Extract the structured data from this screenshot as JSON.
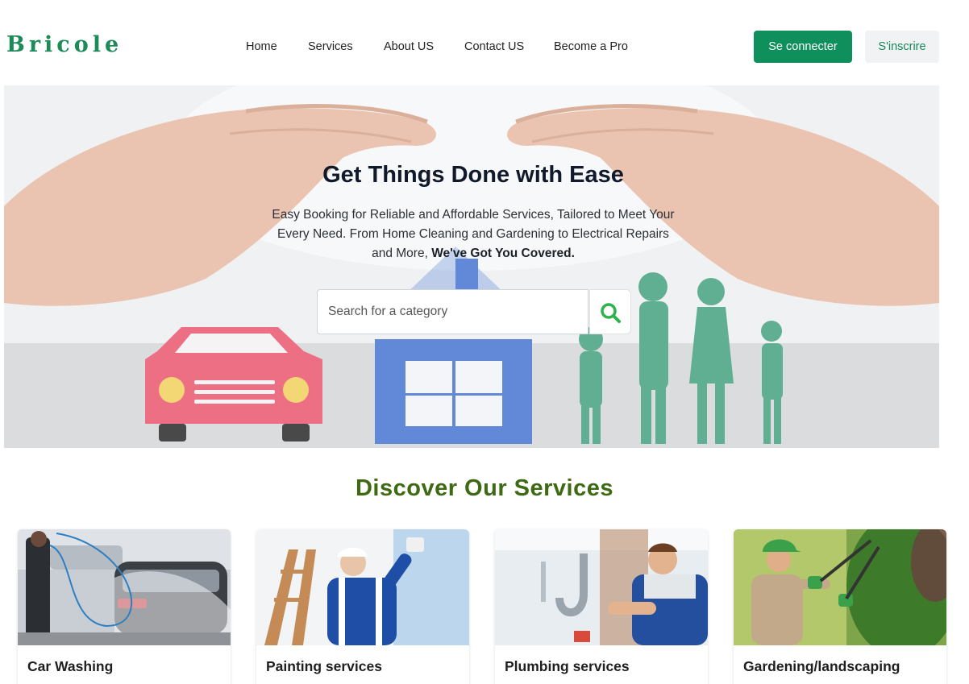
{
  "header": {
    "logo": "Bricole",
    "nav": [
      "Home",
      "Services",
      "About US",
      "Contact US",
      "Become a Pro"
    ],
    "login_label": "Se connecter",
    "signup_label": "S'inscrire"
  },
  "hero": {
    "title": "Get Things Done with Ease",
    "text": "Easy Booking for Reliable and Affordable Services, Tailored to Meet Your Every Need. From Home Cleaning and Gardening to Electrical Repairs and More,",
    "text_bold": "We've Got You Covered.",
    "search_placeholder": "Search for a category",
    "search_icon": "search-icon"
  },
  "services": {
    "title": "Discover Our Services",
    "items": [
      {
        "label": "Car Washing"
      },
      {
        "label": "Painting services"
      },
      {
        "label": "Plumbing services"
      },
      {
        "label": "Gardening/landscaping"
      }
    ]
  },
  "colors": {
    "brand": "#1d8a5a",
    "primary_button": "#0f8f5c",
    "section_title": "#3d6a12"
  }
}
